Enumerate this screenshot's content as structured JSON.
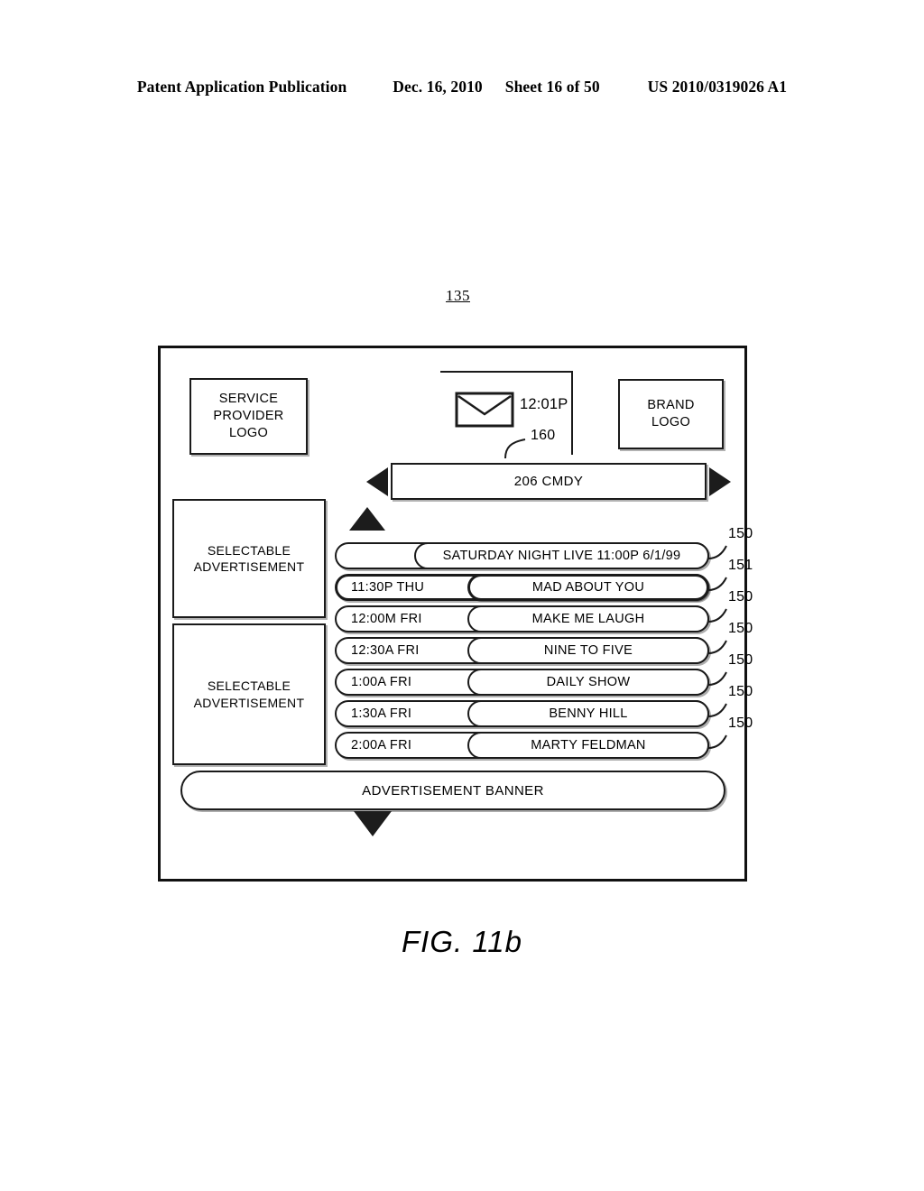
{
  "patent_header": {
    "publication": "Patent Application Publication",
    "date": "Dec. 16, 2010",
    "sheet": "Sheet 16 of 50",
    "number": "US 2010/0319026 A1"
  },
  "figure": {
    "reference_numeral": "135",
    "caption": "FIG. 11b"
  },
  "screen": {
    "service_provider_logo": {
      "line1": "SERVICE",
      "line2": "PROVIDER",
      "line3": "LOGO"
    },
    "brand_logo": {
      "line1": "BRAND",
      "line2": "LOGO"
    },
    "clock": {
      "time": "12:01P",
      "icon": "envelope-icon"
    },
    "channel": {
      "label": "206 CMDY",
      "callout": "160",
      "left_arrow_icon": "triangle-left-icon",
      "right_arrow_icon": "triangle-right-icon"
    },
    "scroll_up_icon": "triangle-up-icon",
    "scroll_down_icon": "triangle-down-icon",
    "advertisements": [
      {
        "line1": "SELECTABLE",
        "line2": "ADVERTISEMENT"
      },
      {
        "line1": "SELECTABLE",
        "line2": "ADVERTISEMENT"
      }
    ],
    "banner": {
      "label": "ADVERTISEMENT BANNER"
    },
    "program_listings": [
      {
        "time": "",
        "title": "SATURDAY NIGHT LIVE   11:00P 6/1/99",
        "callout": "150",
        "highlighted": false,
        "wide": true
      },
      {
        "time": "11:30P  THU",
        "title": "MAD ABOUT YOU",
        "callout": "151",
        "highlighted": true,
        "wide": false
      },
      {
        "time": "12:00M  FRI",
        "title": "MAKE ME LAUGH",
        "callout": "150",
        "highlighted": false,
        "wide": false
      },
      {
        "time": "12:30A  FRI",
        "title": "NINE TO FIVE",
        "callout": "150",
        "highlighted": false,
        "wide": false
      },
      {
        "time": "1:00A    FRI",
        "title": "DAILY SHOW",
        "callout": "150",
        "highlighted": false,
        "wide": false
      },
      {
        "time": "1:30A    FRI",
        "title": "BENNY HILL",
        "callout": "150",
        "highlighted": false,
        "wide": false
      },
      {
        "time": "2:00A    FRI",
        "title": "MARTY FELDMAN",
        "callout": "150",
        "highlighted": false,
        "wide": false
      }
    ]
  }
}
